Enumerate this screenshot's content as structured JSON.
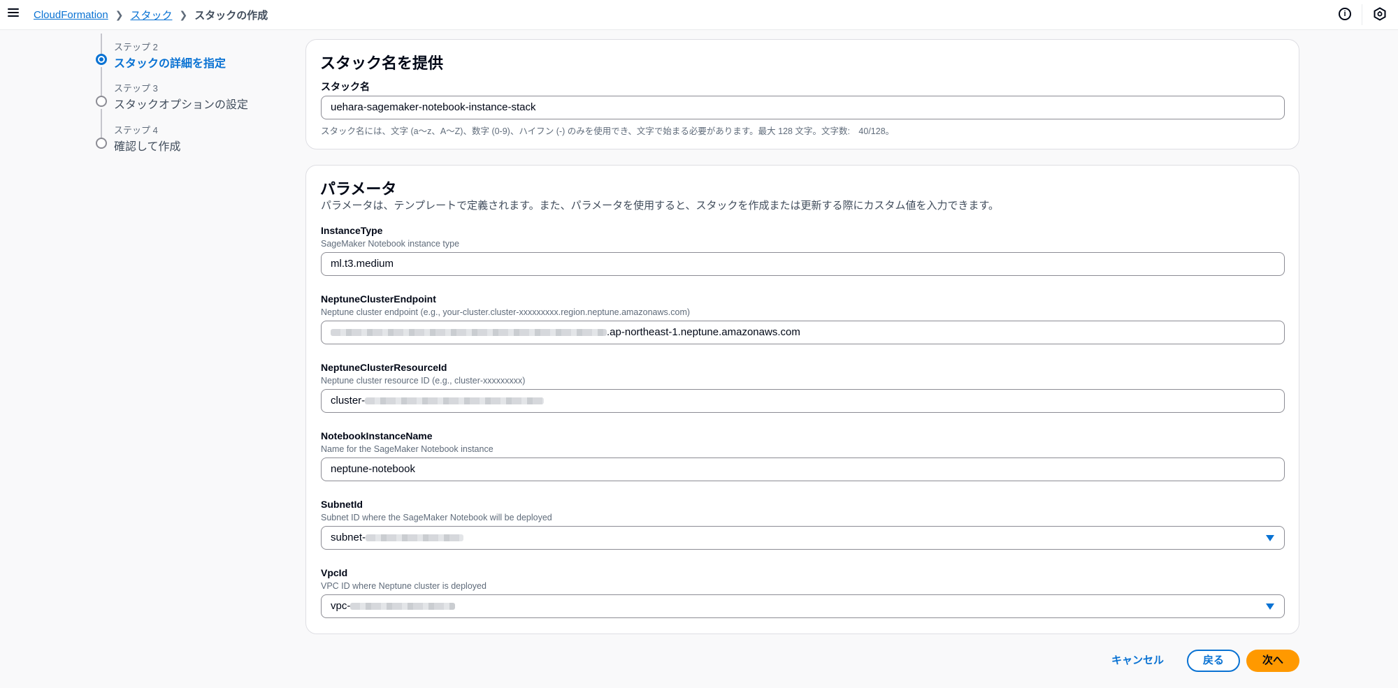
{
  "header": {
    "breadcrumb": [
      "CloudFormation",
      "スタック",
      "スタックの作成"
    ],
    "info_icon": "info-icon",
    "settings_icon": "hexagon-icon"
  },
  "steps": [
    {
      "num": "ステップ 2",
      "title": "スタックの詳細を指定",
      "active": true
    },
    {
      "num": "ステップ 3",
      "title": "スタックオプションの設定",
      "active": false
    },
    {
      "num": "ステップ 4",
      "title": "確認して作成",
      "active": false
    }
  ],
  "stack_name_panel": {
    "title": "スタック名を提供",
    "label": "スタック名",
    "value": "uehara-sagemaker-notebook-instance-stack",
    "hint": "スタック名には、文字 (a〜z、A〜Z)、数字 (0-9)、ハイフン (-) のみを使用でき、文字で始まる必要があります。最大 128 文字。文字数:　40/128。"
  },
  "parameters_panel": {
    "title": "パラメータ",
    "description": "パラメータは、テンプレートで定義されます。また、パラメータを使用すると、スタックを作成または更新する際にカスタム値を入力できます。",
    "fields": [
      {
        "label": "InstanceType",
        "sub": "SageMaker Notebook instance type",
        "value": "ml.t3.medium"
      },
      {
        "label": "NeptuneClusterEndpoint",
        "sub": "Neptune cluster endpoint (e.g., your-cluster.cluster-xxxxxxxxx.region.neptune.amazonaws.com)",
        "value": ".ap-northeast-1.neptune.amazonaws.com"
      },
      {
        "label": "NeptuneClusterResourceId",
        "sub": "Neptune cluster resource ID (e.g., cluster-xxxxxxxxx)",
        "value": "cluster-"
      },
      {
        "label": "NotebookInstanceName",
        "sub": "Name for the SageMaker Notebook instance",
        "value": "neptune-notebook"
      },
      {
        "label": "SubnetId",
        "sub": "Subnet ID where the SageMaker Notebook will be deployed",
        "value": "subnet-"
      },
      {
        "label": "VpcId",
        "sub": "VPC ID where Neptune cluster is deployed",
        "value": "vpc-"
      }
    ]
  },
  "footer": {
    "cancel": "キャンセル",
    "back": "戻る",
    "next": "次へ"
  },
  "colors": {
    "accent": "#0972d3",
    "primary_button": "#ff9900"
  }
}
